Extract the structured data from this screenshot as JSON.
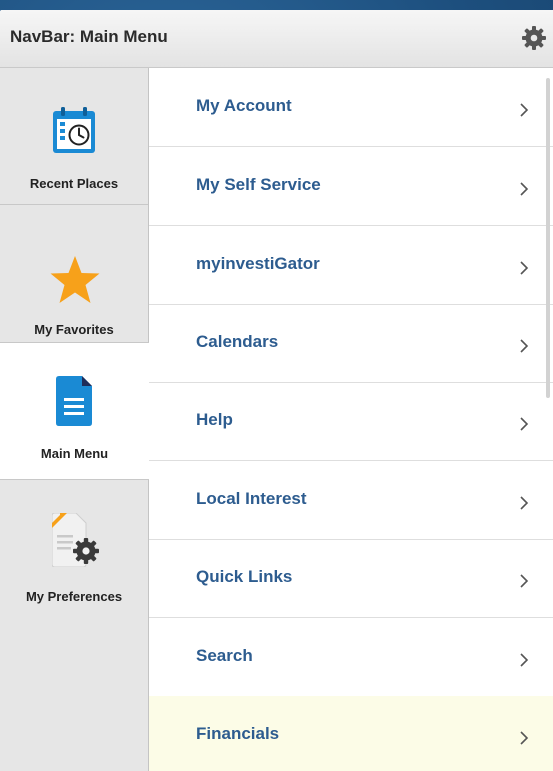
{
  "header": {
    "title": "NavBar: Main Menu",
    "settings_icon": "gear-icon"
  },
  "sidebar": {
    "items": [
      {
        "label": "Recent Places",
        "icon": "calendar-clock-icon",
        "active": false
      },
      {
        "label": "My Favorites",
        "icon": "star-icon",
        "active": false
      },
      {
        "label": "Main Menu",
        "icon": "document-icon",
        "active": true
      },
      {
        "label": "My Preferences",
        "icon": "document-gear-icon",
        "active": false
      }
    ]
  },
  "menu": {
    "items": [
      {
        "label": "My Account"
      },
      {
        "label": "My Self Service"
      },
      {
        "label": "myinvestiGator"
      },
      {
        "label": "Calendars"
      },
      {
        "label": "Help"
      },
      {
        "label": "Local Interest"
      },
      {
        "label": "Quick Links"
      },
      {
        "label": "Search"
      },
      {
        "label": "Financials",
        "highlighted": true
      }
    ]
  },
  "colors": {
    "accent_text": "#2d5c8f",
    "highlight_row": "#fcfce7",
    "star": "#f7a11a",
    "icon_blue": "#1a8ad4"
  }
}
